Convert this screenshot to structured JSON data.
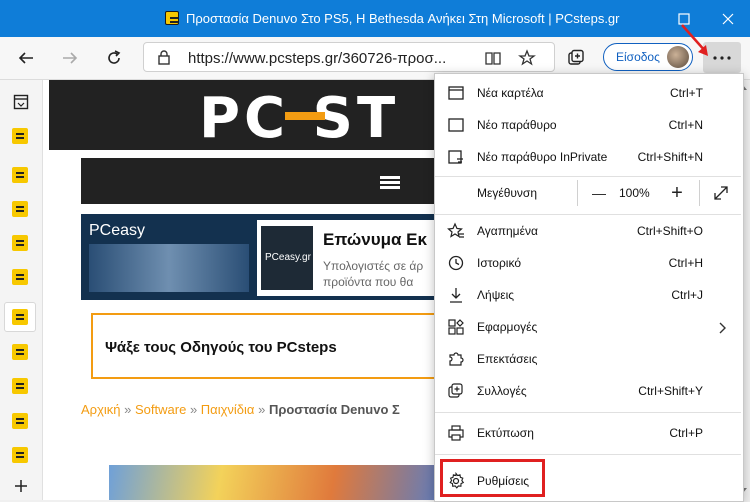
{
  "window": {
    "title": "Προστασία Denuvo Στο PS5, Η Bethesda Ανήκει Στη Microsoft | PCsteps.gr"
  },
  "toolbar": {
    "url": "https://www.pcsteps.gr/360726-προσ...",
    "signin_label": "Είσοδος"
  },
  "page": {
    "logo": "PC ST",
    "banner_brand": "PCeasy",
    "banner_mini": "PCeasy.gr",
    "banner_heading": "Επώνυμα Εκ",
    "banner_sub1": "Υπολογιστές σε άρ",
    "banner_sub2": "προϊόντα που θα",
    "guides": "Ψάξε τους Οδηγούς του PCsteps",
    "breadcrumb": {
      "home": "Αρχική",
      "sep": "»",
      "software": "Software",
      "games": "Παιχνίδια",
      "current": "Προστασία Denuvo Σ"
    }
  },
  "menu": {
    "items": [
      {
        "label": "Νέα καρτέλα",
        "shortcut": "Ctrl+T",
        "icon": "new-tab-icon"
      },
      {
        "label": "Νέο παράθυρο",
        "shortcut": "Ctrl+N",
        "icon": "new-window-icon"
      },
      {
        "label": "Νέο παράθυρο InPrivate",
        "shortcut": "Ctrl+Shift+N",
        "icon": "inprivate-icon"
      }
    ],
    "zoom": {
      "label": "Μεγέθυνση",
      "value": "100%",
      "minus": "—",
      "plus": "+"
    },
    "items2": [
      {
        "label": "Αγαπημένα",
        "shortcut": "Ctrl+Shift+O",
        "icon": "favorites-icon"
      },
      {
        "label": "Ιστορικό",
        "shortcut": "Ctrl+H",
        "icon": "history-icon"
      },
      {
        "label": "Λήψεις",
        "shortcut": "Ctrl+J",
        "icon": "downloads-icon"
      },
      {
        "label": "Εφαρμογές",
        "shortcut": "",
        "icon": "apps-icon"
      },
      {
        "label": "Επεκτάσεις",
        "shortcut": "",
        "icon": "extensions-icon"
      },
      {
        "label": "Συλλογές",
        "shortcut": "Ctrl+Shift+Y",
        "icon": "collections-icon"
      }
    ],
    "print": {
      "label": "Εκτύπωση",
      "shortcut": "Ctrl+P"
    },
    "settings": {
      "label": "Ρυθμίσεις"
    }
  }
}
